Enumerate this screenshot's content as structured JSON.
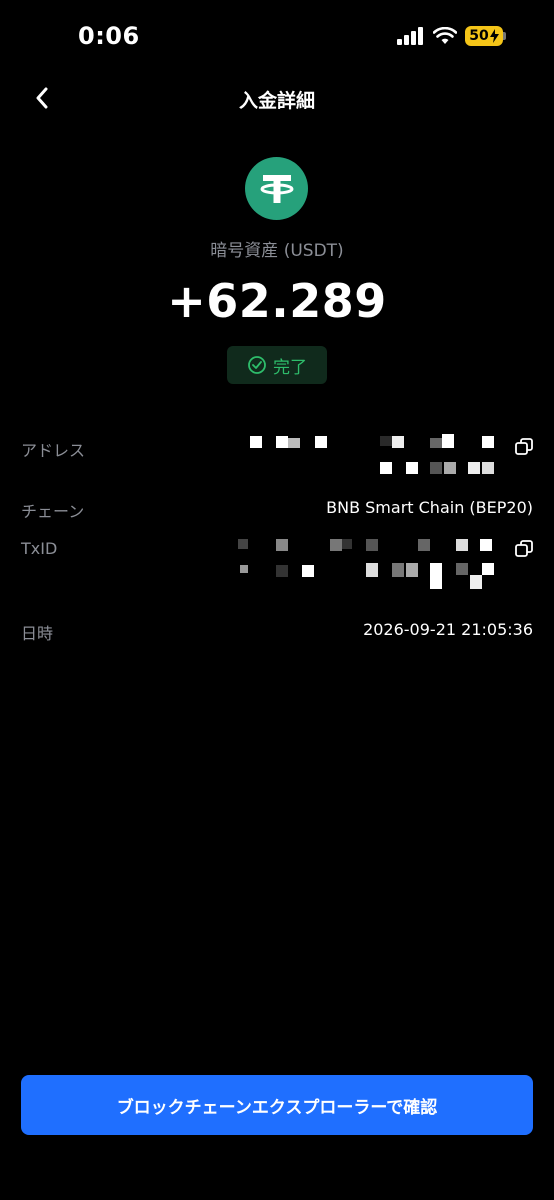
{
  "status_bar": {
    "time": "0:06",
    "battery": "50"
  },
  "nav": {
    "title": "入金詳細"
  },
  "asset": {
    "label": "暗号資産 (USDT)",
    "amount": "+62.289"
  },
  "status": {
    "text": "完了",
    "color": "#2ebd6b"
  },
  "details": {
    "address_label": "アドレス",
    "chain_label": "チェーン",
    "chain_value": "BNB Smart Chain (BEP20)",
    "txid_label": "TxID",
    "datetime_label": "日時",
    "datetime_value": "2026-09-21 21:05:36"
  },
  "action": {
    "explorer_button": "ブロックチェーンエクスプローラーで確認"
  },
  "colors": {
    "accent": "#1f6fff",
    "usdt": "#26a17b",
    "muted": "#8b8e96"
  }
}
